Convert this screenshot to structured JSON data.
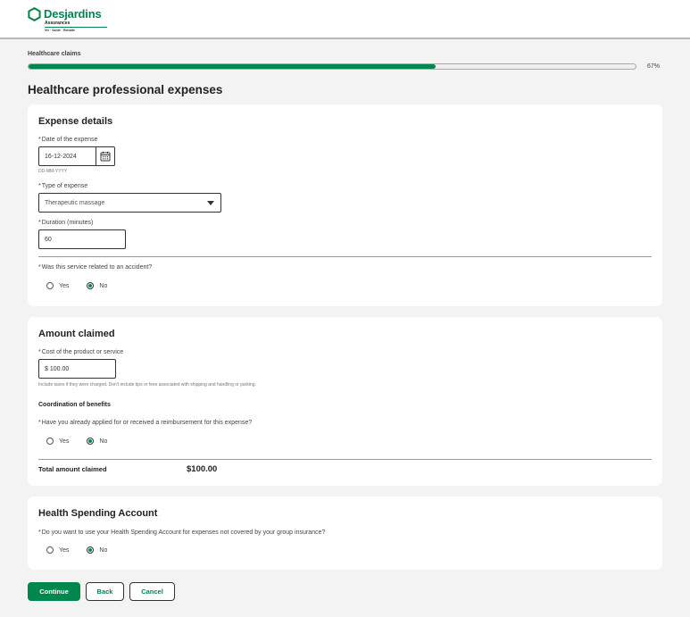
{
  "brand": {
    "name": "Desjardins",
    "sub": "Assurances",
    "tagline": "Vie · Santé · Retraite",
    "color": "#00874e"
  },
  "progress": {
    "label": "Healthcare claims",
    "percent": 67,
    "percent_text": "67%"
  },
  "page_title": "Healthcare professional expenses",
  "expense_details": {
    "title": "Expense details",
    "date": {
      "required_mark": "*",
      "label": "Date of the expense",
      "value": "16-12-2024",
      "format_hint": "DD-MM-YYYY",
      "icon": "calendar-icon"
    },
    "type": {
      "required_mark": "*",
      "label": "Type of expense",
      "value": "Therapeutic massage",
      "icon": "chevron-down-icon"
    },
    "duration": {
      "required_mark": "*",
      "label": "Duration (minutes)",
      "value": "60"
    },
    "accident": {
      "required_mark": "*",
      "question": "Was this service related to an accident?",
      "options": [
        "Yes",
        "No"
      ],
      "selected": "No"
    }
  },
  "amount_claimed": {
    "title": "Amount claimed",
    "cost": {
      "required_mark": "*",
      "label": "Cost of the product or service",
      "value": "$ 100.00",
      "hint": "Include taxes if they were charged. Don't include tips or fees associated with shipping and handling or parking."
    },
    "coordination_heading": "Coordination of benefits",
    "reimbursement": {
      "required_mark": "*",
      "question": "Have you already applied for or received a reimbursement for this expense?",
      "options": [
        "Yes",
        "No"
      ],
      "selected": "No"
    },
    "total_label": "Total amount claimed",
    "total_value": "$100.00"
  },
  "hsa": {
    "title": "Health Spending Account",
    "question_required_mark": "*",
    "question": "Do you want to use your Health Spending Account for expenses not covered by your group insurance?",
    "options": [
      "Yes",
      "No"
    ],
    "selected": "No"
  },
  "buttons": {
    "continue": "Continue",
    "back": "Back",
    "cancel": "Cancel"
  }
}
